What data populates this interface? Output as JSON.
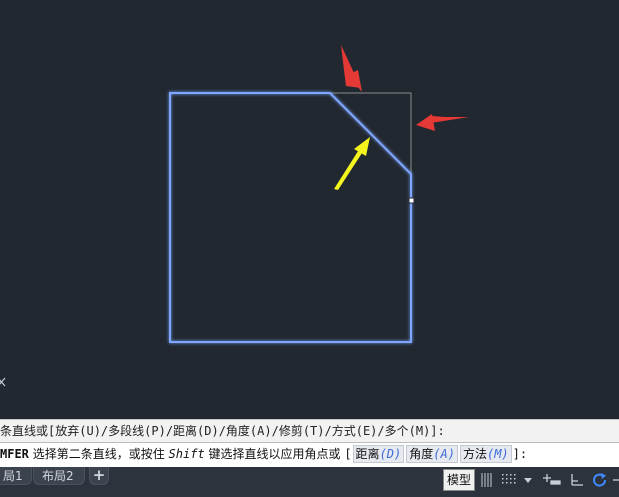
{
  "canvas": {
    "background": "#212830",
    "polyline_color": "#7fa6ff",
    "grip_box_color": "#8c8c8c",
    "arrow_red": "#e53935",
    "arrow_yellow": "#f4f51e"
  },
  "command_history": {
    "text_prefix": "条直线或 ",
    "text_options": "[放弃(U)/多段线(P)/距离(D)/角度(A)/修剪(T)/方式(E)/多个(M)]:"
  },
  "command_line": {
    "command_name": "MFER",
    "prompt_a": " 选择第二条直线，或按住 ",
    "prompt_shift": "Shift",
    "prompt_b": " 键选择直线以应用角点或 ",
    "bracket_open": "[",
    "opt_distance_label": "距离",
    "opt_distance_key": "(D)",
    "opt_angle_label": "角度",
    "opt_angle_key": "(A)",
    "opt_method_label": "方法",
    "opt_method_key": "(M)",
    "bracket_close": "]:"
  },
  "layout_tabs": [
    {
      "label": "局1"
    },
    {
      "label": "布局2"
    }
  ],
  "add_tab_label": "+",
  "status_bar": {
    "model_label": "模型",
    "icons": [
      "grid-icon",
      "snap-icon",
      "dropdown-arrow-icon",
      "ortho-icon",
      "polar-icon",
      "refresh-icon"
    ]
  }
}
